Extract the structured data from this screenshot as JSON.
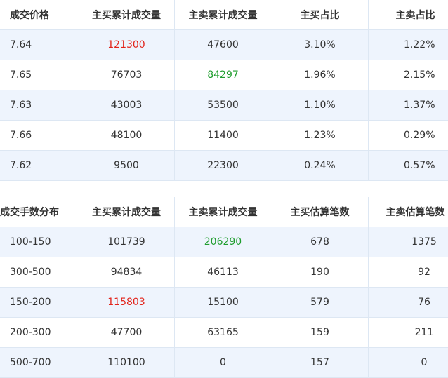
{
  "price_table": {
    "headers": [
      "成交价格",
      "主买累计成交量",
      "主卖累计成交量",
      "主买占比",
      "主卖占比"
    ],
    "rows": [
      [
        "7.64",
        "121300",
        "47600",
        "3.10%",
        "1.22%"
      ],
      [
        "7.65",
        "76703",
        "84297",
        "1.96%",
        "2.15%"
      ],
      [
        "7.63",
        "43003",
        "53500",
        "1.10%",
        "1.37%"
      ],
      [
        "7.66",
        "48100",
        "11400",
        "1.23%",
        "0.29%"
      ],
      [
        "7.62",
        "9500",
        "22300",
        "0.24%",
        "0.57%"
      ]
    ],
    "highlight_colors": {
      "max_buy": "#e2231a",
      "max_sell": "#1f9d2e"
    }
  },
  "volume_table": {
    "headers": [
      "成交手数分布",
      "主买累计成交量",
      "主卖累计成交量",
      "主买估算笔数",
      "主卖估算笔数"
    ],
    "rows": [
      [
        "100-150",
        "101739",
        "206290",
        "678",
        "1375"
      ],
      [
        "300-500",
        "94834",
        "46113",
        "190",
        "92"
      ],
      [
        "150-200",
        "115803",
        "15100",
        "579",
        "76"
      ],
      [
        "200-300",
        "47700",
        "63165",
        "159",
        "211"
      ],
      [
        "500-700",
        "110100",
        "0",
        "157",
        "0"
      ]
    ],
    "highlight_colors": {
      "max_buy": "#e2231a",
      "max_sell": "#1f9d2e"
    }
  },
  "colors": {
    "row_stripe": "#eef4fd",
    "grid": "#dde7f3",
    "text": "#333333"
  }
}
